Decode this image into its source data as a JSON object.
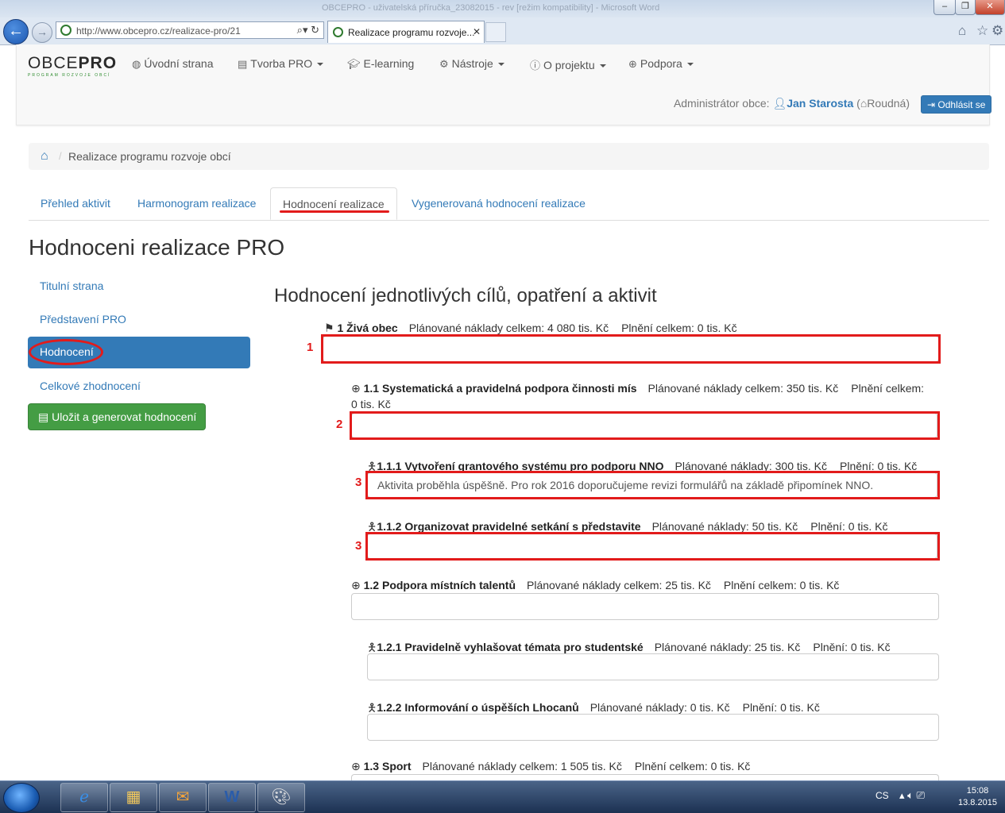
{
  "browser": {
    "window_title": "OBCEPRO - uživatelská příručka_23082015 - rev [režim kompatibility] - Microsoft Word",
    "url": "http://www.obcepro.cz/realizace-pro/21",
    "tab_title": "Realizace programu rozvoje...",
    "icons": [
      "back-arrow-icon",
      "forward-arrow-icon",
      "search-icon",
      "refresh-icon",
      "home-icon",
      "star-icon",
      "gear-icon"
    ]
  },
  "navbar": {
    "logo_main_light": "OBCE",
    "logo_main_bold": "PRO",
    "logo_sub": "PROGRAM ROZVOJE OBCÍ",
    "items": [
      {
        "label": "Úvodní strana",
        "icon": "globe-icon"
      },
      {
        "label": "Tvorba PRO",
        "icon": "document-icon"
      },
      {
        "label": "E-learning",
        "icon": "graduation-cap-icon"
      },
      {
        "label": "Nástroje",
        "icon": "cogs-icon"
      },
      {
        "label": "O projektu",
        "icon": "info-icon"
      },
      {
        "label": "Podpora",
        "icon": "lifebuoy-icon"
      }
    ],
    "admin_prefix": "Administrátor obce:",
    "admin_name": "Jan Starosta",
    "admin_town_open": "(",
    "admin_town": "Roudná)",
    "logout_label": "Odhlásit se"
  },
  "breadcrumb": {
    "current": "Realizace programu rozvoje obcí"
  },
  "tabs": [
    {
      "label": "Přehled aktivit"
    },
    {
      "label": "Harmonogram realizace"
    },
    {
      "label": "Hodnocení realizace",
      "active": true
    },
    {
      "label": "Vygenerovaná hodnocení realizace"
    }
  ],
  "page_title": "Hodnoceni realizace PRO",
  "sidebar": {
    "items": [
      {
        "label": "Titulní strana"
      },
      {
        "label": "Představení PRO"
      },
      {
        "label": "Hodnocení",
        "active": true
      },
      {
        "label": "Celkové zhodnocení"
      }
    ],
    "save_button": "Uložit a generovat hodnocení"
  },
  "section_title": "Hodnocení jednotlivých cílů, opatření a aktivit",
  "items": [
    {
      "title": "1 Živá obec",
      "cost": "Plánované náklady celkem: 4 080 tis. Kč",
      "done": "Plnění celkem: 0 tis. Kč",
      "value": "",
      "marker": "1"
    },
    {
      "title": "1.1 Systematická a pravidelná podpora činnosti mís",
      "cost": "Plánované náklady celkem: 350 tis. Kč",
      "done": "Plnění celkem:",
      "done_wrap": "0 tis. Kč",
      "value": "",
      "marker": "2"
    },
    {
      "title": "1.1.1 Vytvoření grantového systému pro podporu NNO",
      "cost": "Plánované náklady: 300 tis. Kč",
      "done": "Plnění: 0 tis. Kč",
      "value": "Aktivita proběhla úspěšně. Pro rok 2016 doporučujeme revizi formulářů na základě připomínek NNO.",
      "marker": "3"
    },
    {
      "title": "1.1.2 Organizovat pravidelné setkání s představite",
      "cost": "Plánované náklady: 50 tis. Kč",
      "done": "Plnění: 0 tis. Kč",
      "value": "",
      "marker": "3"
    },
    {
      "title": "1.2 Podpora místních talentů",
      "cost": "Plánované náklady celkem: 25 tis. Kč",
      "done": "Plnění celkem: 0 tis. Kč",
      "value": ""
    },
    {
      "title": "1.2.1 Pravidelně vyhlašovat témata pro studentské",
      "cost": "Plánované náklady: 25 tis. Kč",
      "done": "Plnění: 0 tis. Kč",
      "value": ""
    },
    {
      "title": "1.2.2 Informování o úspěších Lhocanů",
      "cost": "Plánované náklady: 0 tis. Kč",
      "done": "Plnění: 0 tis. Kč",
      "value": ""
    },
    {
      "title": "1.3 Sport",
      "cost": "Plánované náklady celkem: 1 505 tis. Kč",
      "done": "Plnění celkem: 0 tis. Kč",
      "value": ""
    }
  ],
  "taskbar": {
    "apps": [
      "internet-explorer-icon",
      "file-explorer-icon",
      "outlook-icon",
      "word-icon",
      "paint-icon"
    ],
    "lang": "CS",
    "time": "15:08",
    "date": "13.8.2015"
  },
  "colors": {
    "accent": "#337ab7",
    "annotation_red": "#e21b1b",
    "success": "#449d44"
  }
}
